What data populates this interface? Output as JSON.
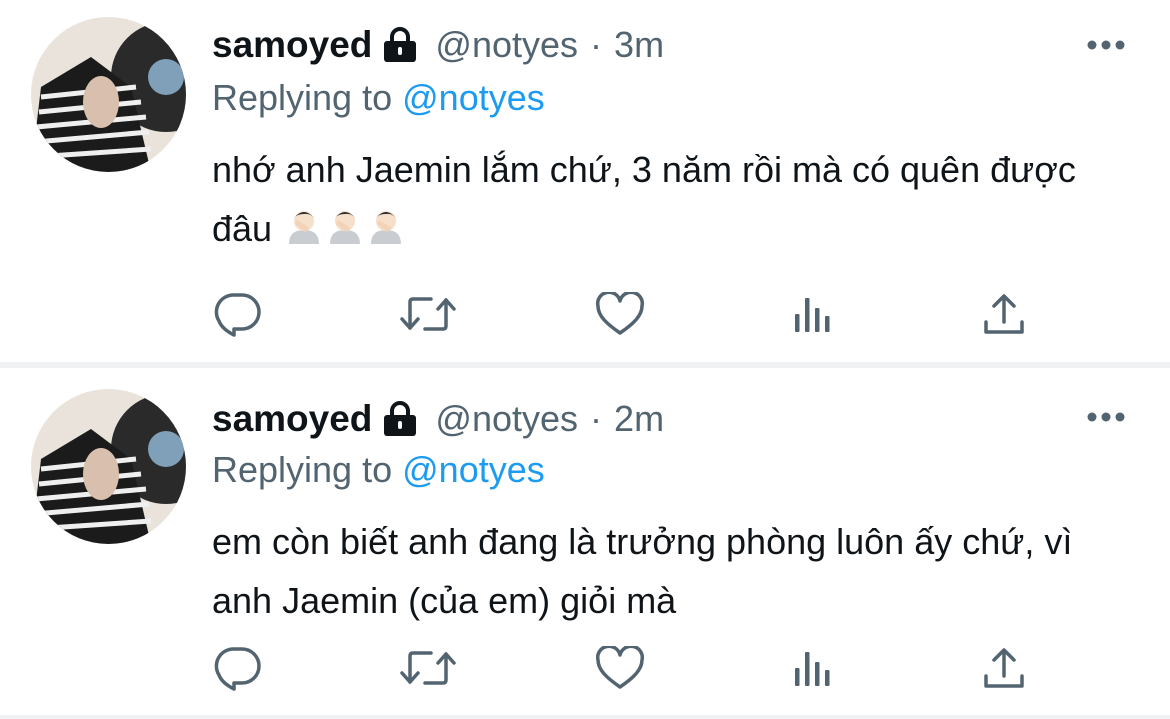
{
  "tweets": [
    {
      "display_name": "samoyed",
      "handle": "@notyes",
      "separator": "·",
      "time": "3m",
      "replying_prefix": "Replying to",
      "replying_to": "@notyes",
      "text": "nhớ anh Jaemin lắm chứ, 3 năm rồi mà có quên được đâu",
      "emoji": [
        "facepalm-man",
        "facepalm-man",
        "facepalm-man"
      ]
    },
    {
      "display_name": "samoyed",
      "handle": "@notyes",
      "separator": "·",
      "time": "2m",
      "replying_prefix": "Replying to",
      "replying_to": "@notyes",
      "text": "em còn biết anh đang là trưởng phòng luôn ấy chứ, vì anh Jaemin (của em) giỏi mà",
      "emoji": []
    }
  ],
  "actions": [
    "reply-icon",
    "retweet-icon",
    "like-icon",
    "views-icon",
    "share-icon"
  ],
  "colors": {
    "link": "#1d9bf0",
    "muted": "#536471",
    "text": "#0f1419",
    "divider": "#eff1f3"
  }
}
